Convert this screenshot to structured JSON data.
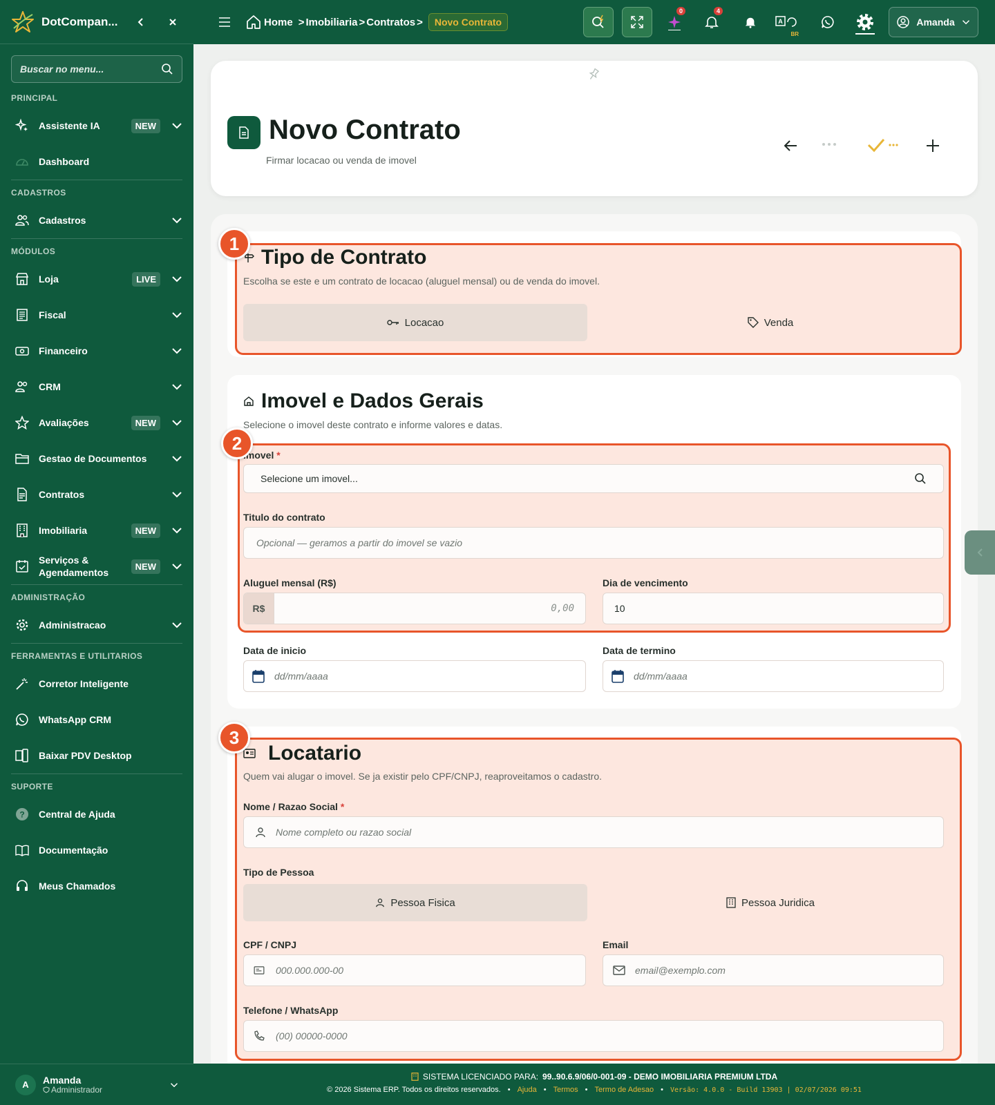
{
  "sidebar": {
    "brand": "DotCompan...",
    "search_placeholder": "Buscar no menu...",
    "sections": {
      "principal": "PRINCIPAL",
      "cadastros": "CADASTROS",
      "modulos": "MÓDULOS",
      "administracao": "ADMINISTRAÇÃO",
      "ferramentas": "FERRAMENTAS E UTILITARIOS",
      "suporte": "SUPORTE"
    },
    "items": {
      "assistente": {
        "label": "Assistente IA",
        "badge": "NEW"
      },
      "dashboard": {
        "label": "Dashboard"
      },
      "cadastros": {
        "label": "Cadastros"
      },
      "loja": {
        "label": "Loja",
        "badge": "LIVE"
      },
      "fiscal": {
        "label": "Fiscal"
      },
      "financeiro": {
        "label": "Financeiro"
      },
      "crm": {
        "label": "CRM"
      },
      "avaliacoes": {
        "label": "Avaliações",
        "badge": "NEW"
      },
      "documentos": {
        "label": "Gestao de Documentos"
      },
      "contratos": {
        "label": "Contratos"
      },
      "imobiliaria": {
        "label": "Imobiliaria",
        "badge": "NEW"
      },
      "servicos": {
        "label": "Serviços & Agendamentos",
        "badge": "NEW"
      },
      "admin": {
        "label": "Administracao"
      },
      "corretor": {
        "label": "Corretor Inteligente"
      },
      "whatsapp": {
        "label": "WhatsApp CRM"
      },
      "pdv": {
        "label": "Baixar PDV Desktop"
      },
      "ajuda": {
        "label": "Central de Ajuda"
      },
      "documentacao": {
        "label": "Documentação"
      },
      "chamados": {
        "label": "Meus Chamados"
      }
    },
    "user": {
      "initial": "A",
      "name": "Amanda",
      "role": "Administrador"
    }
  },
  "topbar": {
    "breadcrumb": [
      "Home",
      "Imobiliaria",
      "Contratos"
    ],
    "current": "Novo Contrato",
    "ai_count": "0",
    "notif_count": "4",
    "lang": "BR",
    "user": "Amanda"
  },
  "header": {
    "title": "Novo Contrato",
    "subtitle": "Firmar locacao ou venda de imovel"
  },
  "tipo": {
    "title": "Tipo de Contrato",
    "subtitle": "Escolha se este e um contrato de locacao (aluguel mensal) ou de venda do imovel.",
    "options": [
      "Locacao",
      "Venda"
    ],
    "selected": "Locacao"
  },
  "imovel": {
    "title": "Imovel e Dados Gerais",
    "subtitle": "Selecione o imovel deste contrato e informe valores e datas.",
    "imovel_label": "Imovel",
    "imovel_placeholder": "Selecione um imovel...",
    "titulo_label": "Titulo do contrato",
    "titulo_placeholder": "Opcional — geramos a partir do imovel se vazio",
    "aluguel_label": "Aluguel mensal (R$)",
    "currency": "R$",
    "aluguel_placeholder": "0,00",
    "dia_label": "Dia de vencimento",
    "dia_value": "10",
    "inicio_label": "Data de inicio",
    "termino_label": "Data de termino",
    "date_placeholder": "dd/mm/aaaa"
  },
  "locatario": {
    "title": "Locatario",
    "subtitle": "Quem vai alugar o imovel. Se ja existir pelo CPF/CNPJ, reaproveitamos o cadastro.",
    "nome_label": "Nome / Razao Social",
    "nome_placeholder": "Nome completo ou razao social",
    "tipo_label": "Tipo de Pessoa",
    "tipo_options": [
      "Pessoa Fisica",
      "Pessoa Juridica"
    ],
    "tipo_selected": "Pessoa Fisica",
    "cpf_label": "CPF / CNPJ",
    "cpf_placeholder": "000.000.000-00",
    "email_label": "Email",
    "email_placeholder": "email@exemplo.com",
    "telefone_label": "Telefone / WhatsApp",
    "telefone_placeholder": "(00) 00000-0000"
  },
  "annotations": [
    "1",
    "2",
    "3"
  ],
  "footer": {
    "license_prefix": "SISTEMA LICENCIADO PARA:",
    "license": "99..90.6.9/06/0-001-09 - DEMO IMOBILIARIA PREMIUM LTDA",
    "copyright": "© 2026 Sistema ERP. Todos os direitos reservados.",
    "links": [
      "Ajuda",
      "Termos",
      "Termo de Adesao"
    ],
    "version": "Versão: 4.0.0 - Build 13903 | 02/07/2026 09:51"
  },
  "colors": {
    "primary": "#0f5a3d",
    "accent": "#e8b638",
    "highlight": "#e8552a"
  }
}
